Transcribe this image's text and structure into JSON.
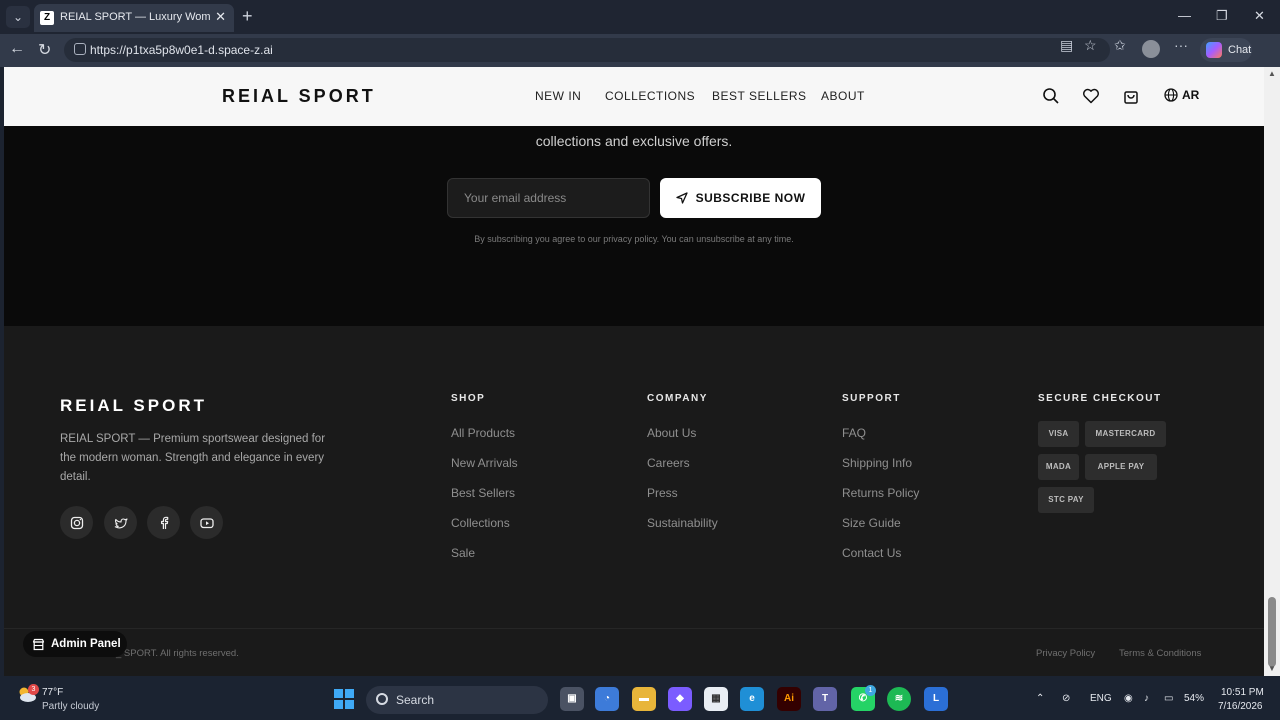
{
  "browser": {
    "tab_title": "REIAL SPORT — Luxury Women's S",
    "favicon_letter": "Z",
    "url": "https://p1txa5p8w0e1-d.space-z.ai",
    "chat_label": "Chat"
  },
  "header": {
    "logo": "REIAL SPORT",
    "nav": [
      "NEW IN",
      "COLLECTIONS",
      "BEST SELLERS",
      "ABOUT"
    ],
    "lang": "AR"
  },
  "newsletter": {
    "text": "collections and exclusive offers.",
    "email_placeholder": "Your email address",
    "subscribe_label": "SUBSCRIBE NOW",
    "disclaimer": "By subscribing you agree to our privacy policy. You can unsubscribe at any time."
  },
  "footer": {
    "logo": "REIAL SPORT",
    "description": "REIAL SPORT — Premium sportswear designed for the modern woman. Strength and elegance in every detail.",
    "social": [
      "instagram-icon",
      "twitter-icon",
      "facebook-icon",
      "youtube-icon"
    ],
    "shop": {
      "heading": "SHOP",
      "links": [
        "All Products",
        "New Arrivals",
        "Best Sellers",
        "Collections",
        "Sale"
      ]
    },
    "company": {
      "heading": "COMPANY",
      "links": [
        "About Us",
        "Careers",
        "Press",
        "Sustainability"
      ]
    },
    "support": {
      "heading": "SUPPORT",
      "links": [
        "FAQ",
        "Shipping Info",
        "Returns Policy",
        "Size Guide",
        "Contact Us"
      ]
    },
    "checkout": {
      "heading": "SECURE CHECKOUT",
      "badges": [
        "VISA",
        "MASTERCARD",
        "MADA",
        "APPLE PAY",
        "STC PAY"
      ]
    },
    "copyright": "_ SPORT. All rights reserved.",
    "legal": [
      "Privacy Policy",
      "Terms & Conditions"
    ]
  },
  "admin_panel": "Admin Panel",
  "taskbar": {
    "weather_badge": "3",
    "temp": "77°F",
    "condition": "Partly cloudy",
    "search": "Search",
    "teams_badge": "1",
    "language": "ENG",
    "battery": "54%",
    "time": "10:51 PM",
    "date": "7/16/2026"
  }
}
